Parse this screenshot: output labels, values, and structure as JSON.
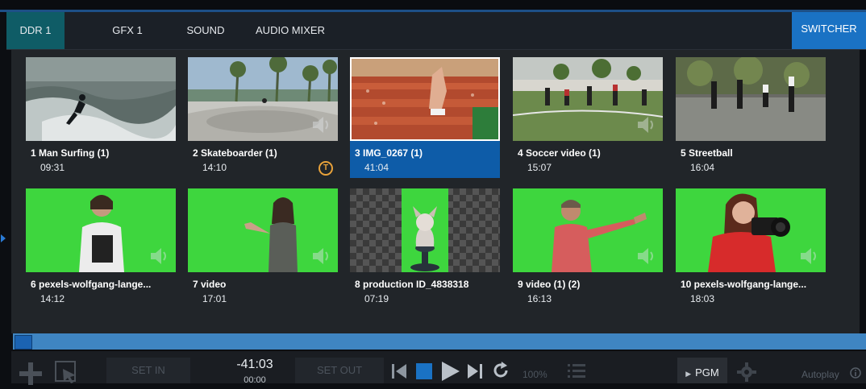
{
  "tabs": [
    {
      "label": "DDR 1",
      "active": true
    },
    {
      "label": "GFX 1",
      "active": false
    },
    {
      "label": "SOUND",
      "active": false
    },
    {
      "label": "AUDIO MIXER",
      "active": false
    }
  ],
  "switcher_label": "SWITCHER",
  "clips": [
    {
      "title": "1 Man Surfing (1)",
      "duration": "09:31",
      "thumbnail": "surfing"
    },
    {
      "title": "2 Skateboarder (1)",
      "duration": "14:10",
      "thumbnail": "skatepark",
      "badge": "T"
    },
    {
      "title": "3 IMG_0267 (1)",
      "duration": "41:04",
      "thumbnail": "stadium",
      "selected": true
    },
    {
      "title": "4 Soccer video (1)",
      "duration": "15:07",
      "thumbnail": "soccer"
    },
    {
      "title": "5 Streetball",
      "duration": "16:04",
      "thumbnail": "streetball"
    },
    {
      "title": "6 pexels-wolfgang-lange...",
      "duration": "14:12",
      "thumbnail": "greenscreen-woman-folder"
    },
    {
      "title": "7 video",
      "duration": "17:01",
      "thumbnail": "greenscreen-woman-presenting"
    },
    {
      "title": "8 production ID_4838318",
      "duration": "07:19",
      "thumbnail": "dog-transparent"
    },
    {
      "title": "9 video (1) (2)",
      "duration": "16:13",
      "thumbnail": "greenscreen-man-pointing"
    },
    {
      "title": "10 pexels-wolfgang-lange...",
      "duration": "18:03",
      "thumbnail": "greenscreen-woman-camera"
    }
  ],
  "playback": {
    "position_fraction": 0.0
  },
  "toolbar": {
    "set_in": "SET IN",
    "set_out": "SET OUT",
    "time_remaining": "-41:03",
    "time_elapsed": "00:00",
    "speed": "100%",
    "output": "PGM",
    "autoplay": "Autoplay"
  },
  "colors": {
    "accent": "#1a72c4",
    "active_tab": "#0f5c66",
    "selection": "#0e5ca8",
    "greenscreen": "#3ed63e",
    "badge": "#e8a23a"
  }
}
